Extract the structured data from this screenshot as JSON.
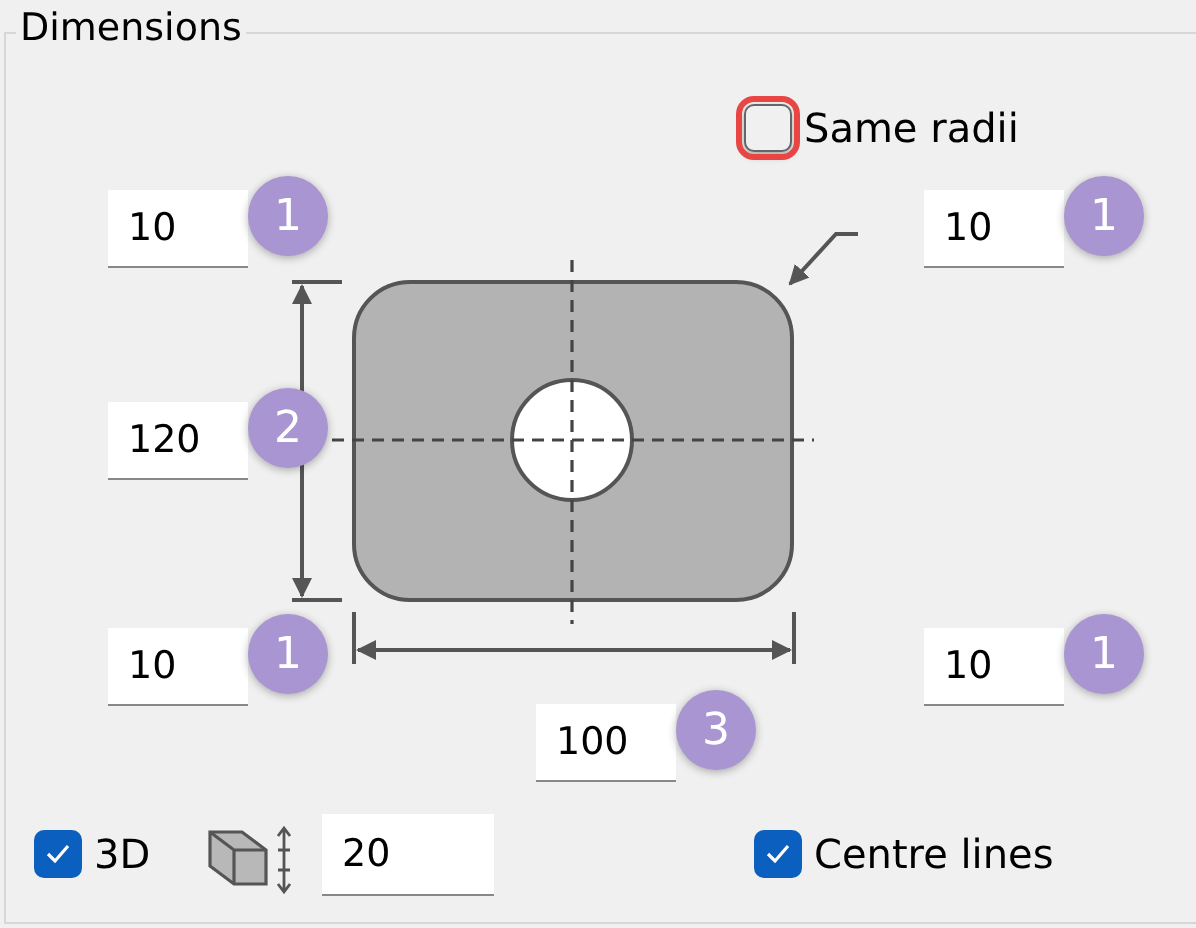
{
  "group": {
    "title": "Dimensions"
  },
  "same_radii": {
    "label": "Same radii",
    "checked": false,
    "highlighted": true
  },
  "fields": [
    {
      "value": "10",
      "badge": "1"
    },
    {
      "value": "10",
      "badge": "1"
    },
    {
      "value": "120",
      "badge": "2"
    },
    {
      "value": "10",
      "badge": "1"
    },
    {
      "value": "10",
      "badge": "1"
    },
    {
      "value": "100",
      "badge": "3"
    }
  ],
  "three_d": {
    "label": "3D",
    "checked": true
  },
  "thickness": {
    "value": "20"
  },
  "centre_lines": {
    "label": "Centre lines",
    "checked": true
  }
}
